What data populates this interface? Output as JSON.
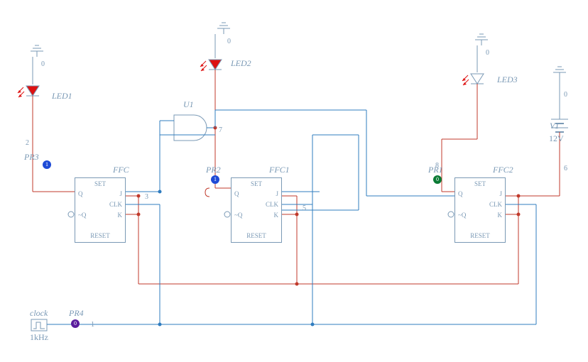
{
  "components": {
    "led1": {
      "name": "LED1"
    },
    "led2": {
      "name": "LED2"
    },
    "led3": {
      "name": "LED3"
    },
    "u1": {
      "name": "U1"
    },
    "v1": {
      "name": "V1",
      "value": "12V"
    },
    "clock": {
      "label": "clock",
      "freq": "1kHz"
    },
    "ffc": {
      "name": "FFC"
    },
    "ffc1": {
      "name": "FFC1"
    },
    "ffc2": {
      "name": "FFC2"
    },
    "pr1": {
      "name": "PR1",
      "value": "0"
    },
    "pr2": {
      "name": "PR2",
      "value": "1"
    },
    "pr3": {
      "name": "PR3",
      "value": "1"
    },
    "pr4": {
      "name": "PR4",
      "value": "0"
    }
  },
  "flipflop_ports": {
    "set": "SET",
    "reset": "RESET",
    "q": "Q",
    "nq": "~Q",
    "j": "J",
    "k": "K",
    "clk": "CLK"
  },
  "net_labels": {
    "n0a": "0",
    "n0b": "0",
    "n0c": "0",
    "n0d": "0",
    "n1": "1",
    "n2": "2",
    "n3": "3",
    "n5": "5",
    "n6": "6",
    "n7": "7",
    "n8": "8"
  }
}
